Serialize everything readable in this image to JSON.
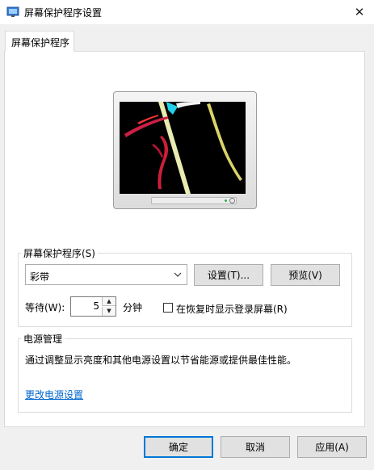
{
  "window": {
    "title": "屏幕保护程序设置",
    "close_glyph": "✕"
  },
  "tab": {
    "label": "屏幕保护程序"
  },
  "screensaver": {
    "group_label": "屏幕保护程序(S)",
    "selected": "彩带",
    "settings_button": "设置(T)...",
    "preview_button": "预览(V)",
    "wait_label": "等待(W):",
    "wait_value": "5",
    "wait_unit": "分钟",
    "resume_checkbox_label": "在恢复时显示登录屏幕(R)",
    "resume_checked": false
  },
  "power": {
    "group_label": "电源管理",
    "description": "通过调整显示亮度和其他电源设置以节省能源或提供最佳性能。",
    "link_text": "更改电源设置"
  },
  "footer": {
    "ok_button": "确定",
    "cancel_button": "取消",
    "apply_button": "应用(A)"
  },
  "colors": {
    "accent": "#0078d7",
    "link": "#0066cc",
    "dialog_bg": "#f0f0f0"
  }
}
